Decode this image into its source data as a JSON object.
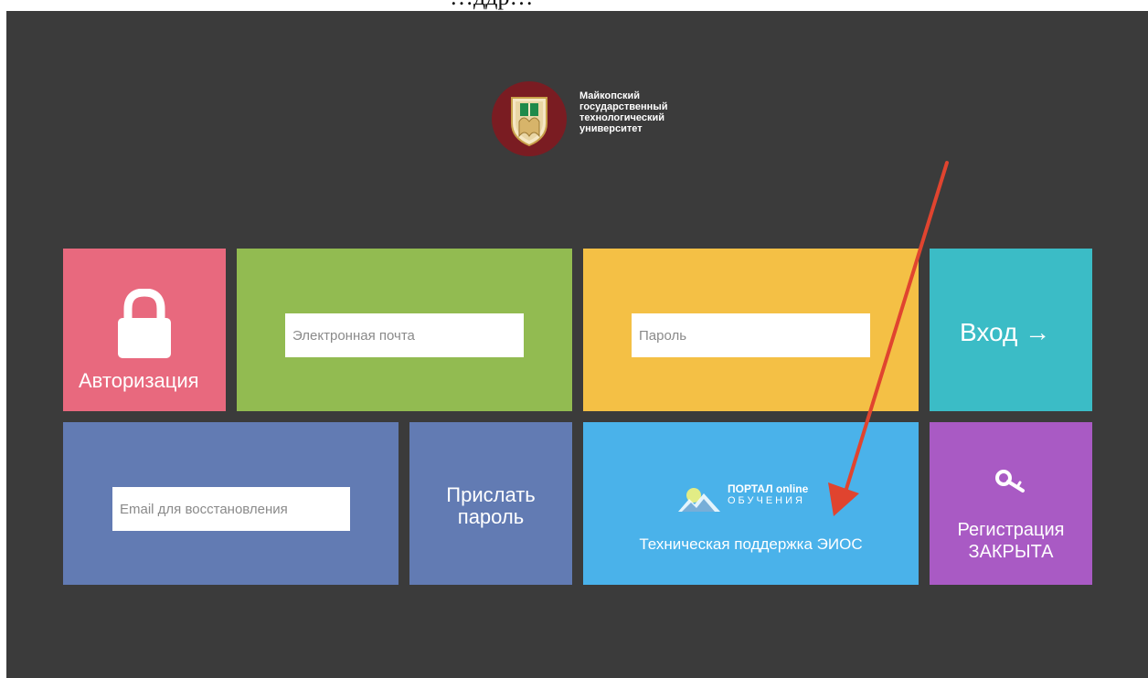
{
  "header_fragment": "…ддр…",
  "brand": {
    "name_lines": [
      "Майкопский",
      "государственный",
      "технологический",
      "университет"
    ],
    "logo": "university-crest-icon"
  },
  "auth_tile": {
    "label": "Авторизация",
    "icon": "lock-icon"
  },
  "email_field": {
    "placeholder": "Электронная почта",
    "value": ""
  },
  "password_field": {
    "placeholder": "Пароль",
    "value": ""
  },
  "login_button": {
    "label": "Вход →"
  },
  "recovery_field": {
    "placeholder": "Email для восстановления",
    "value": ""
  },
  "send_password_button": {
    "label_lines": [
      "Прислать",
      "пароль"
    ]
  },
  "support_tile": {
    "portal_line1": "ПОРТАЛ online",
    "portal_line2": "ОБУЧЕНИЯ",
    "label": "Техническая поддержка ЭИОС",
    "icon": "mountain-icon"
  },
  "register_tile": {
    "label_lines": [
      "Регистрация",
      "ЗАКРЫТА"
    ],
    "icon": "key-icon"
  },
  "colors": {
    "background": "#3b3b3b",
    "auth": "#e8697e",
    "email": "#92bb51",
    "password": "#f4c045",
    "login": "#3bbcc6",
    "recovery": "#627bb3",
    "support": "#4ab2ea",
    "register": "#a95ac4",
    "annotation_arrow": "#e0442f"
  }
}
